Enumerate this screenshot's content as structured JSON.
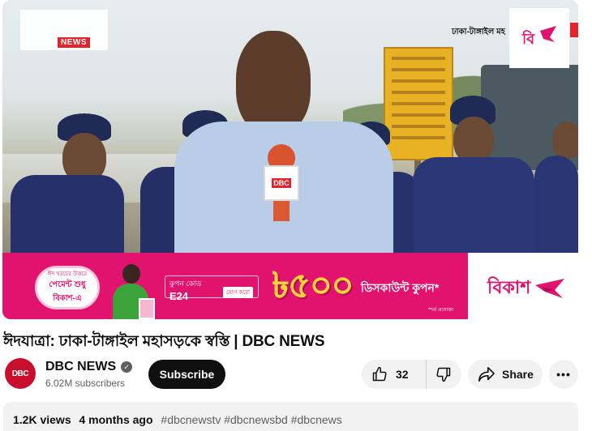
{
  "video": {
    "news_tag": "NEWS",
    "location_text": "ঢাকা-টাঙ্গাইল মহ",
    "mic_logo": "DBC",
    "corner_logo_text": "বি"
  },
  "ad": {
    "promo_small": "ঈদ খরচের উত্তরে",
    "promo_main": "পেমেন্ট শুধু বিকাশ-এ",
    "coupon_label": "কুপন কোড",
    "coupon_code": "E24",
    "coupon_button": "যোগ করো",
    "amount": "৳৫০০",
    "discount_text": "ডিসকাউন্ট কুপন*",
    "terms": "*শর্ত প্রযোজ্য",
    "brand": "বিকাশ",
    "brand_color": "#e2136e"
  },
  "title": "ঈদযাত্রা: ঢাকা-টাঙ্গাইল মহাসড়কে স্বস্তি | DBC NEWS",
  "channel": {
    "avatar_text": "DBC",
    "name": "DBC NEWS",
    "verified_icon": "check-circle-icon",
    "subscribers": "6.02M subscribers",
    "subscribe_label": "Subscribe"
  },
  "actions": {
    "like_count": "32",
    "share_label": "Share",
    "more_label": "•••"
  },
  "description": {
    "views": "1.2K views",
    "age": "4 months ago",
    "tags": "#dbcnewstv #dbcnewsbd #dbcnews"
  }
}
